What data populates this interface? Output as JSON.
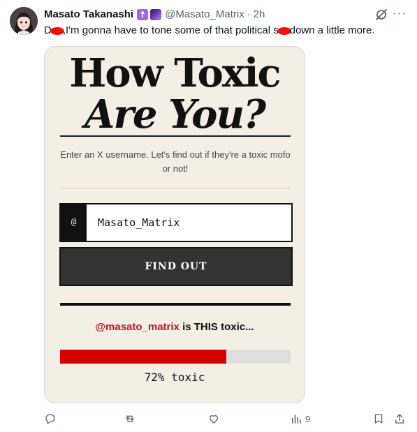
{
  "tweet": {
    "author_name": "Masato Takanashi",
    "handle": "@Masato_Matrix",
    "separator": "·",
    "time": "2h",
    "text_part1": "D",
    "text_part2": ",I'm gonna have to tone some of that political s",
    "text_part3": "down a little more.",
    "badge1_symbol": "☨",
    "more_label": "···"
  },
  "card": {
    "title_line1": "How Toxic",
    "title_line2": "Are You?",
    "description": "Enter an X username. Let's find out if they're a toxic mofo or not!",
    "at_prefix": "@",
    "username_value": "Masato_Matrix",
    "button_label": "FIND OUT",
    "result_username": "@masato_matrix",
    "result_text": " is THIS toxic...",
    "toxicity_percent": 72,
    "toxicity_label": "72% toxic"
  },
  "actions": {
    "views_count": "9"
  },
  "colors": {
    "card_bg": "#f4efe5",
    "accent_red": "#d40000",
    "username_red": "#c4102a",
    "button_bg": "#333333",
    "meta_gray": "#536471"
  },
  "icons": [
    "grok-icon",
    "more-icon",
    "reply-icon",
    "retweet-icon",
    "like-icon",
    "views-icon",
    "bookmark-icon",
    "share-icon"
  ]
}
